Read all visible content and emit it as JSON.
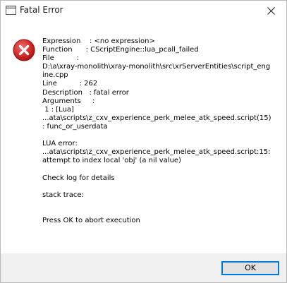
{
  "window": {
    "title": "Fatal Error",
    "close_icon": "close-icon",
    "app_icon": "window-app-icon"
  },
  "dialog": {
    "icon": "error-icon",
    "icon_color": "#e81123",
    "lines": [
      "Expression    : <no expression>",
      "Function      : CScriptEngine::lua_pcall_failed",
      "File          :",
      "D:\\a\\xray-monolith\\xray-monolith\\src\\xrServerEntities\\script_engine.cpp",
      "Line          : 262",
      "Description   : fatal error",
      "Arguments     :",
      " 1 : [Lua]",
      "...ata\\scripts\\z_cxv_experience_perk_melee_atk_speed.script(15) : func_or_userdata",
      "",
      "LUA error:",
      "...ata\\scripts\\z_cxv_experience_perk_melee_atk_speed.script:15: attempt to index local 'obj' (a nil value)",
      "",
      "Check log for details",
      "",
      "stack trace:",
      "",
      "",
      "Press OK to abort execution"
    ]
  },
  "footer": {
    "ok_label": "OK",
    "accent_color": "#0078d7"
  }
}
